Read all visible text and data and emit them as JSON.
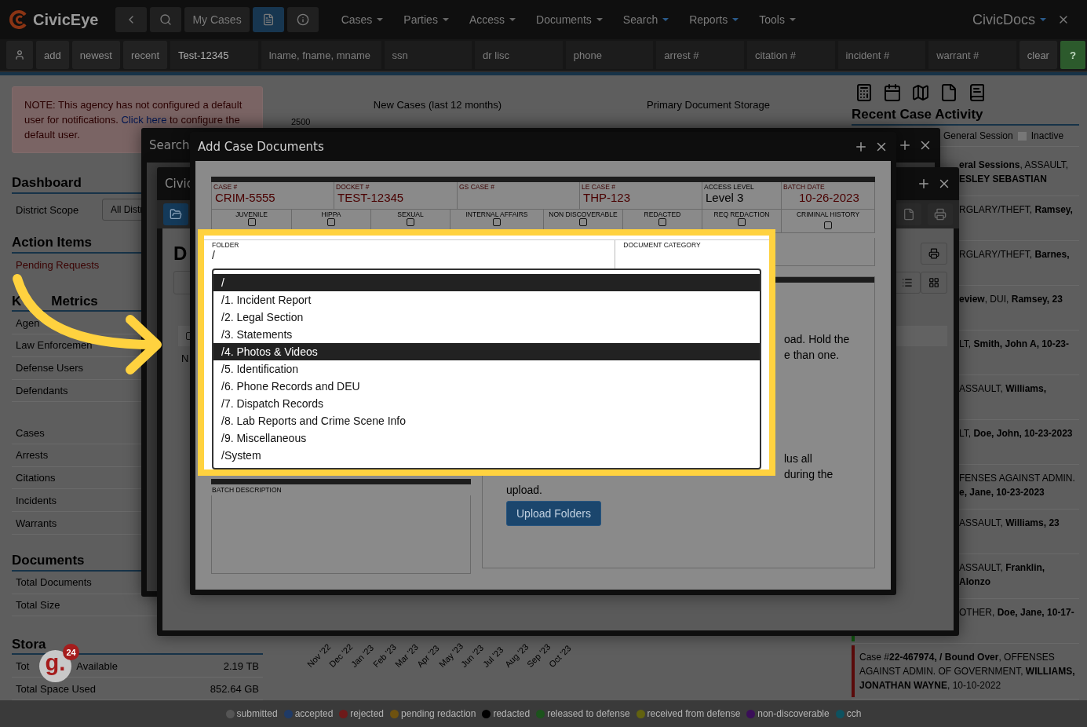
{
  "header": {
    "logo": "CivicEye",
    "my_cases": "My Cases",
    "menus": [
      {
        "label": "Cases",
        "highlighted": false
      },
      {
        "label": "Parties",
        "highlighted": false
      },
      {
        "label": "Access",
        "highlighted": false
      },
      {
        "label": "Documents",
        "highlighted": false
      },
      {
        "label": "Search",
        "highlighted": true
      },
      {
        "label": "Reports",
        "highlighted": true
      },
      {
        "label": "Tools",
        "highlighted": false
      }
    ],
    "brand": "CivicDocs"
  },
  "search_bar": {
    "buttons": [
      "add",
      "newest",
      "recent"
    ],
    "fields": [
      {
        "value": "Test-12345"
      },
      {
        "placeholder": "lname, fname, mname"
      },
      {
        "placeholder": "ssn"
      },
      {
        "placeholder": "dr lisc"
      },
      {
        "placeholder": "phone"
      },
      {
        "placeholder": "arrest #"
      },
      {
        "placeholder": "citation #"
      },
      {
        "placeholder": "incident #"
      },
      {
        "placeholder": "warrant #"
      }
    ],
    "clear": "clear",
    "help": "?"
  },
  "notice": {
    "before": "NOTE: This agency has not configured a default user for notifications.",
    "link": "Click here",
    "after": "to configure the default user."
  },
  "sidebar": {
    "dashboard": {
      "title": "Dashboard",
      "scope_label": "District Scope",
      "scope_value": "All Distr"
    },
    "action_items": {
      "title": "Action Items",
      "link": "Pending Requests"
    },
    "key_metrics": {
      "title_start": "K",
      "title_end": "Metrics",
      "rows": [
        "Agen",
        "Law Enforcemen",
        "Defense Users",
        "Defendants"
      ],
      "rows_2": [
        "Cases",
        "Arrests",
        "Citations",
        "Incidents",
        "Warrants"
      ]
    },
    "documents": {
      "title": "Documents",
      "rows": [
        "Total Documents",
        "Total Size"
      ]
    },
    "storage": {
      "title": "Stora",
      "rows": [
        {
          "label": "Tot",
          "label_after": "Available",
          "value": "2.19 TB"
        },
        {
          "label": "Total Space Used",
          "value": "852.64 GB"
        }
      ]
    }
  },
  "center": {
    "chart_title": "New Cases (last 12 months)",
    "y_tick": "2500",
    "storage_title": "Primary Document Storage",
    "months": [
      "Nov '22",
      "Dec '22",
      "Jan '23",
      "Feb '23",
      "Mar '23",
      "Apr '23",
      "May '23",
      "Jun '23",
      "Jul '23",
      "Aug '23",
      "Sep '23",
      "Oct '23"
    ]
  },
  "recent": {
    "title": "Recent Case Activity",
    "legend": [
      "General Session",
      "Inactive"
    ],
    "items": [
      {
        "text": "**eral Sessions**, ASSAULT, **ESLEY SEBASTIAN**",
        "clipped": true
      },
      {
        "text": "RGLARY/THEFT, **Ramsey,**",
        "clipped": true
      },
      {
        "text": "RGLARY/THEFT, **Barnes,**",
        "clipped": true
      },
      {
        "text": "**eview**, DUI, **Ramsey, 23**",
        "clipped": true
      },
      {
        "text": "LT, **Smith, John A, 10-23-**",
        "clipped": true
      },
      {
        "text": "ASSAULT, **Williams,**",
        "clipped": true
      },
      {
        "text": "LT, **Doe, John, 10-23-2023**",
        "clipped": true
      },
      {
        "text": "FENSES AGAINST ADMIN. **e, Jane, 10-23-2023**",
        "clipped": true
      },
      {
        "text": "ASSAULT, **Williams, 23**",
        "clipped": true
      },
      {
        "text": "ASSAULT, **Franklin, Alonzo**",
        "clipped": true
      },
      {
        "text": "OTHER, **Doe, Jane, 10-17-**",
        "clipped": true,
        "color": "#0f5a0f"
      },
      {
        "text": "Case #**22-467974, / Bound Over**, OFFENSES AGAINST ADMIN. OF GOVERNMENT, **WILLIAMS, JONATHAN WAYNE**, 10-10-2022",
        "clipped": false,
        "color": "#5a0a0a"
      }
    ]
  },
  "legend": [
    {
      "label": "submitted",
      "color": "#555555"
    },
    {
      "label": "accepted",
      "color": "#1f3a66"
    },
    {
      "label": "rejected",
      "color": "#6e1a1a"
    },
    {
      "label": "pending redaction",
      "color": "#6e5210"
    },
    {
      "label": "redacted",
      "color": "#000000"
    },
    {
      "label": "released to defense",
      "color": "#1c531c"
    },
    {
      "label": "received from defense",
      "color": "#62620f"
    },
    {
      "label": "non-discoverable",
      "color": "#3a0e58"
    },
    {
      "label": "cch",
      "color": "#0e5260"
    }
  ],
  "search_window": {
    "title": "Search"
  },
  "civic_window": {
    "title": "Civic",
    "heading": "D",
    "checked": false,
    "row_text": "N"
  },
  "dialog": {
    "title": "Add Case Documents",
    "fields": [
      {
        "label": "CASE #",
        "value": "CRIM-5555",
        "kind": "case"
      },
      {
        "label": "DOCKET #",
        "value": "TEST-12345",
        "kind": "case"
      },
      {
        "label": "GS CASE #",
        "kind": "case"
      },
      {
        "label": "LE CASE #",
        "value": "THP-123",
        "kind": "case"
      },
      {
        "label": "ACCESS LEVEL",
        "value": "Level 3",
        "kind": "plain"
      },
      {
        "label": "BATCH DATE",
        "value": "10-26-2023",
        "kind": "case"
      }
    ],
    "flags": [
      {
        "label": "JUVENILE",
        "checked": false
      },
      {
        "label": "HIPPA",
        "checked": false
      },
      {
        "label": "SEXUAL",
        "checked": false
      },
      {
        "label": "INTERNAL AFFAIRS",
        "checked": false
      },
      {
        "label": "NON DISCOVERABLE",
        "checked": false
      },
      {
        "label": "REDACTED",
        "checked": false
      },
      {
        "label": "REQ REDACTION",
        "checked": false
      },
      {
        "label": "CRIMINAL HISTORY",
        "checked": false
      }
    ],
    "folder": {
      "label": "FOLDER",
      "value": "/"
    },
    "category": {
      "label": "DOCUMENT CATEGORY"
    },
    "folder_options": [
      {
        "label": "/",
        "selected": true
      },
      {
        "label": "/1. Incident Report",
        "selected": false
      },
      {
        "label": "/2. Legal Section",
        "selected": false
      },
      {
        "label": "/3. Statements",
        "selected": false
      },
      {
        "label": "/4. Photos & Videos",
        "selected": true
      },
      {
        "label": "/5. Identification",
        "selected": false
      },
      {
        "label": "/6. Phone Records and DEU",
        "selected": false
      },
      {
        "label": "/7. Dispatch Records",
        "selected": false
      },
      {
        "label": "/8. Lab Reports and Crime Scene Info",
        "selected": false
      },
      {
        "label": "/9. Miscellaneous",
        "selected": false
      },
      {
        "label": "/System",
        "selected": false
      }
    ],
    "batch_description": "BATCH DESCRIPTION",
    "upload_text_1": [
      "oad. Hold the",
      "e than one."
    ],
    "upload_text_2": [
      "lus all",
      "during the"
    ],
    "upload_text_end": "upload.",
    "upload_button": "Upload Folders"
  },
  "widget": {
    "logo": "g.",
    "count": "24"
  }
}
